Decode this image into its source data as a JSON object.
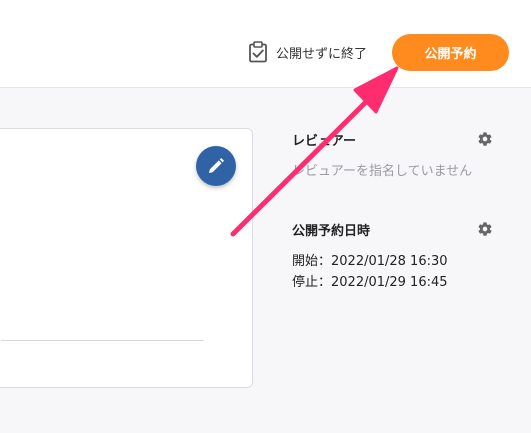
{
  "header": {
    "finish_without_publish_label": "公開せずに終了",
    "publish_schedule_button": "公開予約"
  },
  "sidebar": {
    "reviewer": {
      "title": "レビュアー",
      "empty_message": "レビュアーを指名していません"
    },
    "schedule": {
      "title": "公開予約日時",
      "start": "開始：2022/01/28 16:30",
      "end": "停止：2022/01/29 16:45"
    }
  },
  "icons": {
    "finish": "clipboard-check-icon",
    "edit": "pencil-icon",
    "settings": "gear-icon"
  },
  "colors": {
    "accent": "#ff8b1f",
    "fab": "#3063a6",
    "annotation_arrow": "#ff2d6f"
  }
}
